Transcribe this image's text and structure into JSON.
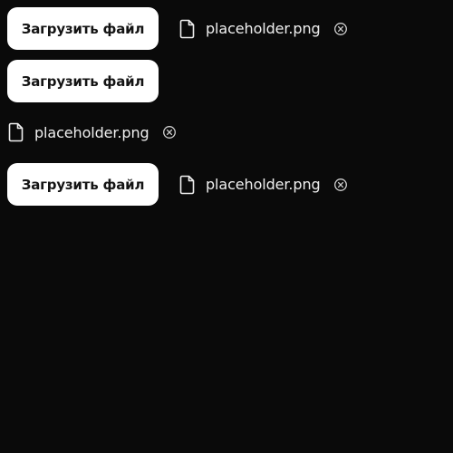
{
  "uploaders": [
    {
      "button_label": "Загрузить файл",
      "file": {
        "name": "placeholder.png",
        "icon": "file-icon",
        "remove_icon": "close-circle-icon"
      }
    },
    {
      "button_label": "Загрузить файл"
    },
    {
      "file": {
        "name": "placeholder.png",
        "icon": "file-icon",
        "remove_icon": "close-circle-icon"
      }
    },
    {
      "button_label": "Загрузить файл",
      "file": {
        "name": "placeholder.png",
        "icon": "file-icon",
        "remove_icon": "close-circle-icon"
      }
    }
  ],
  "colors": {
    "background": "#0a0a0a",
    "button_bg": "#ffffff",
    "button_text": "#141414",
    "file_text": "#f0f0f0"
  }
}
